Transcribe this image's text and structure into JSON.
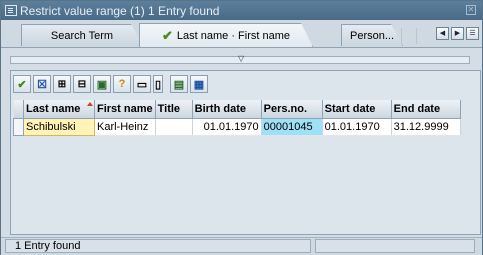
{
  "window": {
    "title": "Restrict value range (1)   1 Entry found",
    "close_glyph": "✕"
  },
  "tabs": [
    {
      "label": "Search Term",
      "active": false
    },
    {
      "label": "Last name · First name",
      "active": true
    },
    {
      "label": "Person...",
      "active": false
    }
  ],
  "tab_nav": {
    "prev": "◀",
    "next": "▶",
    "list": "☰"
  },
  "toolbar": {
    "icons": [
      "check-icon",
      "cancel-icon",
      "find-icon",
      "find-next-icon",
      "sum-icon",
      "help-icon",
      "print-icon",
      "print-preview-icon",
      "export-icon",
      "layout-icon"
    ]
  },
  "table": {
    "columns": [
      "Last name",
      "First name",
      "Title",
      "Birth date",
      "Pers.no.",
      "Start date",
      "End date"
    ],
    "rows": [
      {
        "last_name": "Schibulski",
        "first_name": "Karl-Heinz",
        "title": "",
        "birth_date": "01.01.1970",
        "pers_no": "00001045",
        "start_date": "01.01.1970",
        "end_date": "31.12.9999"
      }
    ]
  },
  "status": {
    "text": "1 Entry found"
  },
  "colors": {
    "titlebar": "#4a6a86",
    "selected_cell": "#fff3b5",
    "highlight_cell": "#9fe0f6",
    "checkmark": "#4a8a1f"
  }
}
